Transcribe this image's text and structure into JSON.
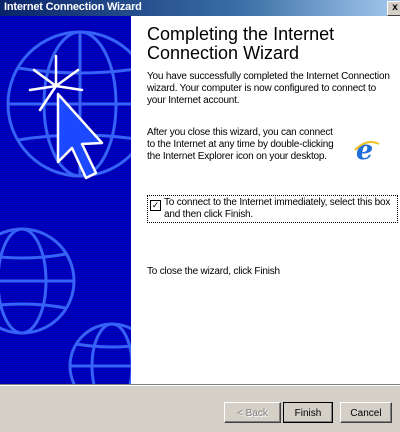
{
  "window": {
    "title": "Internet Connection Wizard",
    "close_label": "x"
  },
  "content": {
    "heading": "Completing the Internet Connection Wizard",
    "paragraph1": "You have successfully completed the Internet Connection wizard. Your computer is now configured to connect to your Internet account.",
    "paragraph2": "After you close this wizard, you can connect to the Internet at any time by double-clicking the Internet Explorer icon on your desktop.",
    "checkbox": {
      "label": "To connect to the Internet immediately, select this box and then click Finish.",
      "checked": true,
      "mark": "✓"
    },
    "paragraph3": "To close the wizard, click Finish"
  },
  "buttons": {
    "back": "< Back",
    "finish": "Finish",
    "cancel": "Cancel"
  },
  "icons": {
    "side_art": "globe-cursor-art",
    "ie": "internet-explorer-icon"
  },
  "colors": {
    "title_bar": "#0a246a",
    "side_panel": "#0000b8",
    "face": "#d4d0c8",
    "ie_blue": "#1e6fd9"
  }
}
